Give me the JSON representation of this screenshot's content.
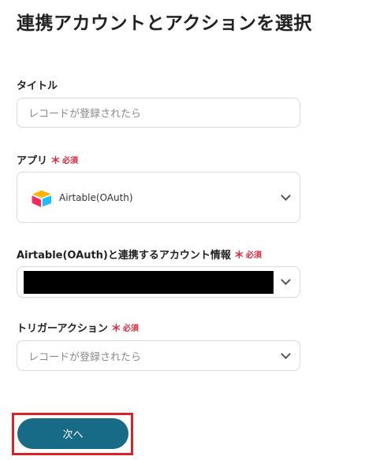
{
  "page_title": "連携アカウントとアクションを選択",
  "fields": {
    "title": {
      "label": "タイトル",
      "placeholder": "レコードが登録されたら"
    },
    "app": {
      "label": "アプリ",
      "required": "必須",
      "selected": "Airtable(OAuth)",
      "icon": "airtable-logo-icon"
    },
    "account": {
      "label": "Airtable(OAuth)と連携するアカウント情報",
      "required": "必須"
    },
    "trigger": {
      "label": "トリガーアクション",
      "required": "必須",
      "selected": "レコードが登録されたら"
    }
  },
  "next_button": "次へ",
  "colors": {
    "primary_button": "#186b86",
    "required": "#e0243c",
    "highlight_border": "#d9222a"
  }
}
